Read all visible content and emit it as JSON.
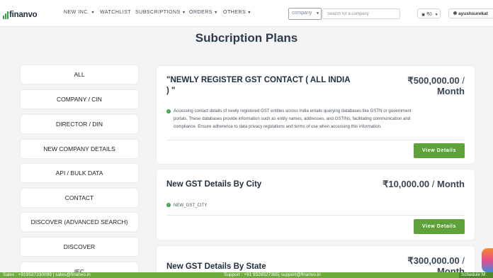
{
  "header": {
    "logo_text": "finanvo",
    "nav": [
      "NEW INC.",
      "WATCHLIST",
      "SUBSCRIPTIONS",
      "ORDERS",
      "OTHERS"
    ],
    "search_type": "company",
    "search_placeholder": "Search for a company",
    "wallet": "₹0",
    "user": "ayushsurekat"
  },
  "page_title": "Subcription Plans",
  "sidebar": {
    "items": [
      "ALL",
      "COMPANY / CIN",
      "DIRECTOR / DIN",
      "NEW COMPANY DETAILS",
      "API / BULK DATA",
      "CONTACT",
      "DISCOVER (ADVANCED SEARCH)",
      "DISCOVER",
      "IEC"
    ]
  },
  "plans": [
    {
      "title_line1": "\"NEWLY REGISTER GST CONTACT ( ALL INDIA",
      "title_line2": ") \"",
      "price": "₹500,000.00",
      "per": " / ",
      "period": "Month",
      "desc_line1": "Accessing contact details of newly registered GST entities across India entails querying databases like GSTN or government",
      "desc_line2": "portals. These databases provide information such as entity names, addresses, and GSTINs, facilitating communication and",
      "desc_line3": "compliance. Ensure adherence to data privacy regulations and terms of use when accessing this information.",
      "button": "View Details"
    },
    {
      "title": "New GST Details By City",
      "price": "₹10,000.00",
      "per": " / ",
      "period": "Month",
      "feature": "NEW_GST_CITY",
      "button": "View Details"
    },
    {
      "title": "New GST Details By State",
      "price": "₹300,000.00",
      "per": " / ",
      "period": "Month"
    }
  ],
  "footer": {
    "sales": "Sales : +919537330099 | sales@finanvo.in",
    "support": "Support : +91 9328527395| support@finanvo.in",
    "schedule": "Schedule M"
  },
  "colors": {
    "accent_green": "#5fa23a",
    "footer_green": "#6eab3f",
    "page_bg": "#f4f4f4"
  }
}
